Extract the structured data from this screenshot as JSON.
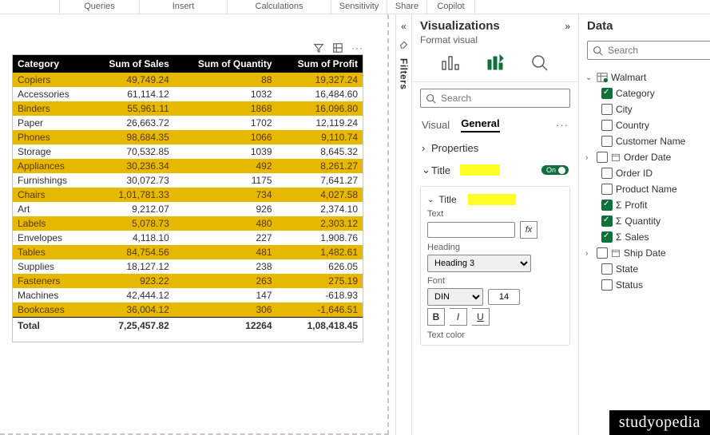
{
  "ribbon": [
    "Queries",
    "Insert",
    "Calculations",
    "Sensitivity",
    "Share",
    "Copilot"
  ],
  "filters_label": "Filters",
  "viz": {
    "title": "Visualizations",
    "subtitle": "Format visual",
    "search_ph": "Search",
    "tabs": {
      "visual": "Visual",
      "general": "General"
    },
    "properties": "Properties",
    "title_group": "Title",
    "toggle_on": "On",
    "text_label": "Text",
    "heading_label": "Heading",
    "heading_value": "Heading 3",
    "font_label": "Font",
    "font_name": "DIN",
    "font_size": "14",
    "text_color_label": "Text color"
  },
  "data_panel": {
    "title": "Data",
    "search_ph": "Search",
    "table_name": "Walmart",
    "fields": [
      {
        "label": "Category",
        "checked": true,
        "kind": "text"
      },
      {
        "label": "City",
        "checked": false,
        "kind": "text"
      },
      {
        "label": "Country",
        "checked": false,
        "kind": "text"
      },
      {
        "label": "Customer Name",
        "checked": false,
        "kind": "text"
      },
      {
        "label": "Order Date",
        "checked": false,
        "kind": "date",
        "exp": true
      },
      {
        "label": "Order ID",
        "checked": false,
        "kind": "text"
      },
      {
        "label": "Product Name",
        "checked": false,
        "kind": "text"
      },
      {
        "label": "Profit",
        "checked": true,
        "kind": "num"
      },
      {
        "label": "Quantity",
        "checked": true,
        "kind": "num"
      },
      {
        "label": "Sales",
        "checked": true,
        "kind": "num"
      },
      {
        "label": "Ship Date",
        "checked": false,
        "kind": "date",
        "exp": true
      },
      {
        "label": "State",
        "checked": false,
        "kind": "text"
      },
      {
        "label": "Status",
        "checked": false,
        "kind": "text"
      }
    ]
  },
  "chart_data": {
    "type": "table",
    "columns": [
      "Category",
      "Sum of Sales",
      "Sum of Quantity",
      "Sum of Profit"
    ],
    "rows": [
      [
        "Copiers",
        "49,749.24",
        "88",
        "19,327.24"
      ],
      [
        "Accessories",
        "61,114.12",
        "1032",
        "16,484.60"
      ],
      [
        "Binders",
        "55,961.11",
        "1868",
        "16,096.80"
      ],
      [
        "Paper",
        "26,663.72",
        "1702",
        "12,119.24"
      ],
      [
        "Phones",
        "98,684.35",
        "1066",
        "9,110.74"
      ],
      [
        "Storage",
        "70,532.85",
        "1039",
        "8,645.32"
      ],
      [
        "Appliances",
        "30,236.34",
        "492",
        "8,261.27"
      ],
      [
        "Furnishings",
        "30,072.73",
        "1175",
        "7,641.27"
      ],
      [
        "Chairs",
        "1,01,781.33",
        "734",
        "4,027.58"
      ],
      [
        "Art",
        "9,212.07",
        "926",
        "2,374.10"
      ],
      [
        "Labels",
        "5,078.73",
        "480",
        "2,303.12"
      ],
      [
        "Envelopes",
        "4,118.10",
        "227",
        "1,908.76"
      ],
      [
        "Tables",
        "84,754.56",
        "481",
        "1,482.61"
      ],
      [
        "Supplies",
        "18,127.12",
        "238",
        "626.05"
      ],
      [
        "Fasteners",
        "923.22",
        "263",
        "275.19"
      ],
      [
        "Machines",
        "42,444.12",
        "147",
        "-618.93"
      ],
      [
        "Bookcases",
        "36,004.12",
        "306",
        "-1,646.51"
      ]
    ],
    "total_label": "Total",
    "totals": [
      "7,25,457.82",
      "12264",
      "1,08,418.45"
    ]
  },
  "watermark": "studyopedia"
}
